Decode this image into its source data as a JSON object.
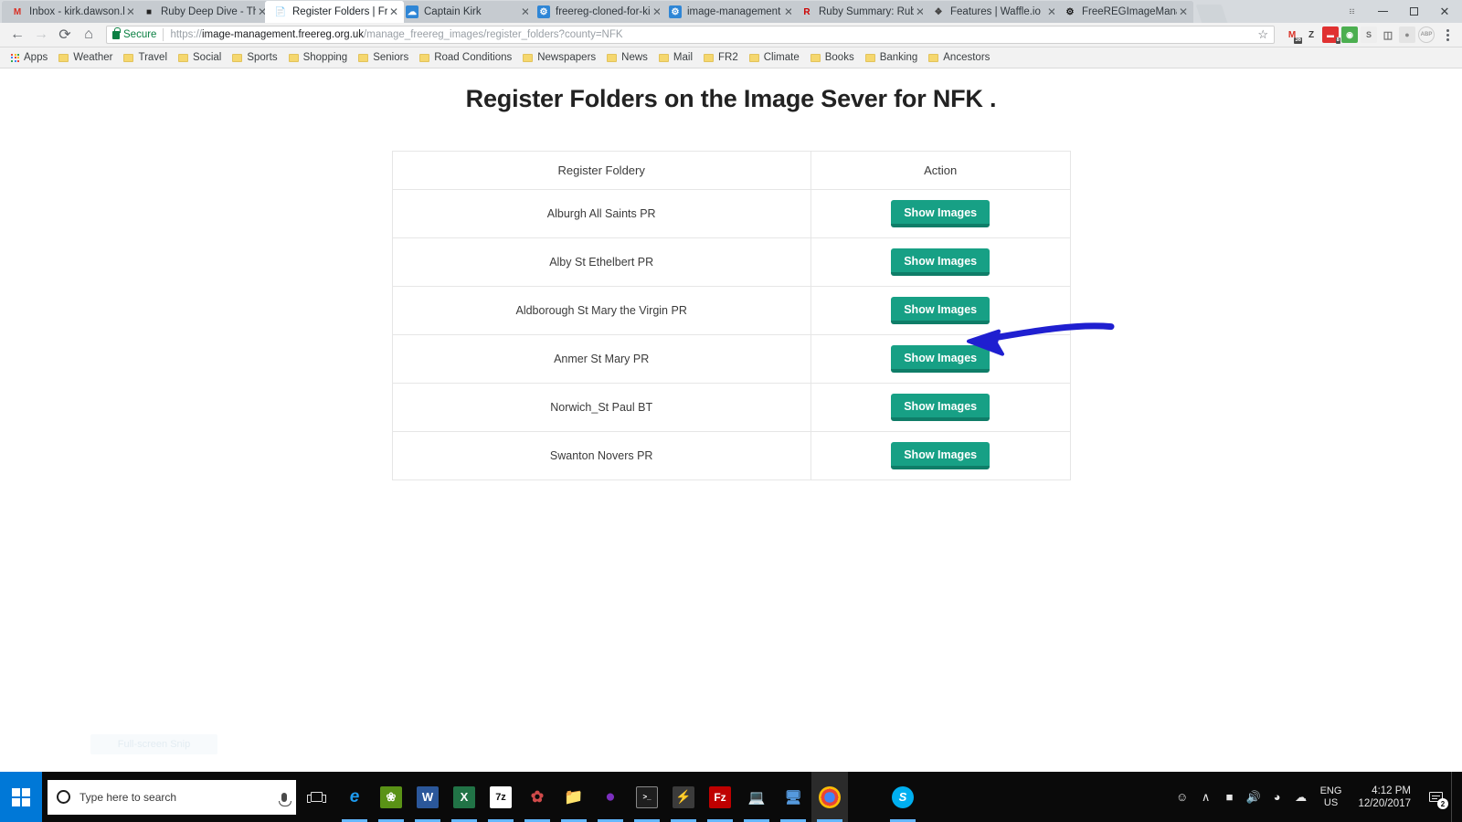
{
  "browser": {
    "tabs": [
      {
        "title": "Inbox - kirk.dawson.bc",
        "favicon": "gmail-icon",
        "active": false
      },
      {
        "title": "Ruby Deep Dive - The I",
        "favicon": "square-dark-icon",
        "active": false
      },
      {
        "title": "Register Folders | FreeR",
        "favicon": "page-icon",
        "active": true
      },
      {
        "title": "Captain Kirk",
        "favicon": "blue-cloud-icon",
        "active": false
      },
      {
        "title": "freereg-cloned-for-kirk",
        "favicon": "blue-gear-icon",
        "active": false
      },
      {
        "title": "image-management - G",
        "favicon": "blue-gear-icon",
        "active": false
      },
      {
        "title": "Ruby Summary: Ruby S",
        "favicon": "ruby-r-icon",
        "active": false
      },
      {
        "title": "Features | Waffle.io",
        "favicon": "waffle-icon",
        "active": false
      },
      {
        "title": "FreeREGImageManage",
        "favicon": "github-icon",
        "active": false
      }
    ],
    "close_glyph": "✕",
    "window_controls": {
      "minimize": "minimize-icon",
      "maximize": "maximize-icon",
      "restore_dots": "≡"
    },
    "nav": {
      "back": "←",
      "forward": "→",
      "reload": "⟳",
      "home": "⌂"
    },
    "omnibox": {
      "security_label": "Secure",
      "url_scheme": "https://",
      "url_host": "image-management.freereg.org.uk",
      "url_path": "/manage_freereg_images/register_folders?county=NFK",
      "star": "☆"
    },
    "extensions": [
      {
        "name": "gmail-extension-icon",
        "glyph": "M",
        "color": "#d93025",
        "bg": "#ffffff",
        "badge": "36"
      },
      {
        "name": "zotero-extension-icon",
        "glyph": "Z",
        "color": "#3c3c3c",
        "bg": "#ffffff",
        "badge": ""
      },
      {
        "name": "pocket-extension-icon",
        "glyph": "▬",
        "color": "#ffffff",
        "bg": "#e03131",
        "badge": "8"
      },
      {
        "name": "grammarly-extension-icon",
        "glyph": "ⓘ",
        "color": "#ffffff",
        "bg": "#4caf50",
        "badge": ""
      },
      {
        "name": "screencast-extension-icon",
        "glyph": "S",
        "color": "#6b6b6b",
        "bg": "#eeeeee",
        "badge": ""
      },
      {
        "name": "cast-icon",
        "glyph": "❐",
        "color": "#6b6b6b",
        "bg": "#f2f2f2",
        "badge": ""
      },
      {
        "name": "user-extension-icon",
        "glyph": "●",
        "color": "#8a8a8a",
        "bg": "#e4e4e4",
        "badge": ""
      },
      {
        "name": "adblock-plus-icon",
        "glyph": "ABP",
        "color": "#9a9a9a",
        "bg": "#f0f0f0",
        "badge": ""
      }
    ],
    "bookmarks": {
      "apps_label": "Apps",
      "items": [
        "Weather",
        "Travel",
        "Social",
        "Sports",
        "Shopping",
        "Seniors",
        "Road Conditions",
        "Newspapers",
        "News",
        "Mail",
        "FR2",
        "Climate",
        "Books",
        "Banking",
        "Ancestors"
      ]
    }
  },
  "page": {
    "title": "Register Folders on the Image Sever for NFK .",
    "table": {
      "headers": [
        "Register Foldery",
        "Action"
      ],
      "button_label": "Show Images",
      "rows": [
        {
          "folder": "Alburgh All Saints PR",
          "action": "Show Images"
        },
        {
          "folder": "Alby St Ethelbert PR",
          "action": "Show Images"
        },
        {
          "folder": "Aldborough St Mary the Virgin PR",
          "action": "Show Images"
        },
        {
          "folder": "Anmer St Mary PR",
          "action": "Show Images"
        },
        {
          "folder": "Norwich_St Paul BT",
          "action": "Show Images"
        },
        {
          "folder": "Swanton Novers PR",
          "action": "Show Images"
        }
      ]
    },
    "annotation": {
      "type": "hand-drawn-arrow",
      "color": "#1f1fd0",
      "points_to_row": "Anmer St Mary PR"
    },
    "ghost_tooltip": "Full-screen Snip",
    "accent_button_color": "#17a085"
  },
  "taskbar": {
    "search_placeholder": "Type here to search",
    "apps": [
      {
        "name": "edge-icon",
        "glyph": "e",
        "color": "#ffffff",
        "bg": "#0a0a0a",
        "running": true
      },
      {
        "name": "leaf-app-icon",
        "glyph": "❀",
        "color": "#ffffff",
        "bg": "#4f8a10",
        "running": true
      },
      {
        "name": "word-icon",
        "glyph": "W",
        "color": "#ffffff",
        "bg": "#2b579a",
        "running": true
      },
      {
        "name": "excel-icon",
        "glyph": "X",
        "color": "#ffffff",
        "bg": "#217346",
        "running": true
      },
      {
        "name": "sevenzip-icon",
        "glyph": "7z",
        "color": "#1a1a1a",
        "bg": "#ffffff",
        "running": true
      },
      {
        "name": "paint-icon",
        "glyph": "✿",
        "color": "#ffffff",
        "bg": "#c94b4b",
        "running": true
      },
      {
        "name": "file-explorer-icon",
        "glyph": "▭",
        "color": "#f7c144",
        "bg": "#0a0a0a",
        "running": true
      },
      {
        "name": "gitkraken-icon",
        "glyph": "●",
        "color": "#7b2fbe",
        "bg": "#0a0a0a",
        "running": true
      },
      {
        "name": "command-prompt-icon",
        "glyph": ">_",
        "color": "#ffffff",
        "bg": "#1e1e1e",
        "running": true
      },
      {
        "name": "sublime-text-icon",
        "glyph": "⚡",
        "color": "#ff9800",
        "bg": "#3b3b3b",
        "running": true
      },
      {
        "name": "filezilla-icon",
        "glyph": "Fz",
        "color": "#ffffff",
        "bg": "#bf0000",
        "running": true
      },
      {
        "name": "remote-desktop-icon",
        "glyph": "⌨",
        "color": "#5599dd",
        "bg": "#0a0a0a",
        "running": true
      },
      {
        "name": "network-computer-icon",
        "glyph": "⌨",
        "color": "#5599dd",
        "bg": "#0a0a0a",
        "running": true
      },
      {
        "name": "chrome-icon",
        "glyph": "●",
        "color": "#4285f4",
        "bg": "#2b2b2b",
        "running": true
      },
      {
        "name": "skype-icon",
        "glyph": "S",
        "color": "#ffffff",
        "bg": "#00aff0",
        "running": true
      }
    ],
    "tray": {
      "people_icon": "people-icon",
      "chevron_icon": "∧",
      "battery_icon": "battery-icon",
      "volume_icon": "🔊",
      "wifi_icon": "wifi-icon",
      "onedrive_icon": "cloud-icon",
      "language_line1": "ENG",
      "language_line2": "US",
      "time": "4:12 PM",
      "date": "12/20/2017",
      "notification_count": "2"
    }
  }
}
